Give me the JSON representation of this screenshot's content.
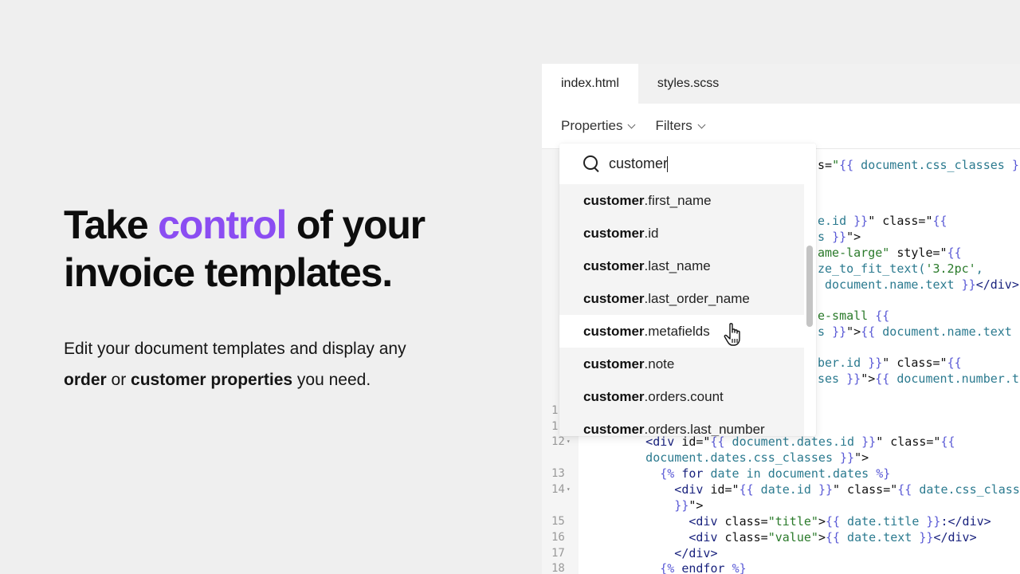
{
  "hero": {
    "headline_pre": "Take ",
    "headline_accent": "control",
    "headline_post": " of your",
    "headline_line2": "invoice templates.",
    "sub_line1": "Edit your document templates and display any",
    "sub_bold1": "order",
    "sub_mid": " or ",
    "sub_bold2": "customer properties",
    "sub_end": " you need.",
    "accent_color": "#8b4df2"
  },
  "editor": {
    "tabs": [
      {
        "label": "index.html",
        "active": true
      },
      {
        "label": "styles.scss",
        "active": false
      }
    ],
    "toolbar": {
      "properties_label": "Properties",
      "filters_label": "Filters",
      "chevron_icon": "chevron-down-icon"
    },
    "code_lines": [
      {
        "num": "",
        "segments": [
          {
            "c": "t-plain",
            "t": "s="
          },
          {
            "c": "t-str",
            "t": "\""
          },
          {
            "c": "t-brace",
            "t": "{{"
          },
          {
            "c": "t-var",
            "t": " document.css_classes "
          },
          {
            "c": "t-brace",
            "t": "}"
          }
        ]
      },
      {
        "num": "",
        "segments": [
          {
            "c": "t-var",
            "t": "e.id "
          },
          {
            "c": "t-brace",
            "t": "}}"
          },
          {
            "c": "t-plain",
            "t": "\" class=\""
          },
          {
            "c": "t-brace",
            "t": "{{"
          }
        ]
      },
      {
        "num": "",
        "segments": [
          {
            "c": "t-var",
            "t": "s "
          },
          {
            "c": "t-brace",
            "t": "}}"
          },
          {
            "c": "t-plain",
            "t": "\">"
          }
        ]
      },
      {
        "num": "",
        "segments": [
          {
            "c": "t-str",
            "t": "ame-large\""
          },
          {
            "c": "t-plain",
            "t": " style=\""
          },
          {
            "c": "t-brace",
            "t": "{{"
          }
        ]
      },
      {
        "num": "",
        "segments": [
          {
            "c": "t-var",
            "t": "ze_to_fit_text("
          },
          {
            "c": "t-str",
            "t": "'3.2pc'"
          },
          {
            "c": "t-var",
            "t": ","
          }
        ]
      },
      {
        "num": "",
        "segments": [
          {
            "c": "t-var",
            "t": " document.name.text "
          },
          {
            "c": "t-brace",
            "t": "}}"
          },
          {
            "c": "t-tag",
            "t": "</div>"
          }
        ]
      },
      {
        "num": "",
        "segments": [
          {
            "c": "t-str",
            "t": "e-small "
          },
          {
            "c": "t-brace",
            "t": "{{"
          }
        ]
      },
      {
        "num": "",
        "segments": [
          {
            "c": "t-var",
            "t": "s "
          },
          {
            "c": "t-brace",
            "t": "}}"
          },
          {
            "c": "t-plain",
            "t": "\">"
          },
          {
            "c": "t-brace",
            "t": "{{"
          },
          {
            "c": "t-var",
            "t": " document.name.text"
          }
        ]
      },
      {
        "num": "",
        "segments": [
          {
            "c": "t-var",
            "t": "ber.id "
          },
          {
            "c": "t-brace",
            "t": "}}"
          },
          {
            "c": "t-plain",
            "t": "\" class=\""
          },
          {
            "c": "t-brace",
            "t": "{{"
          }
        ]
      },
      {
        "num": "",
        "segments": [
          {
            "c": "t-var",
            "t": "ses "
          },
          {
            "c": "t-brace",
            "t": "}}"
          },
          {
            "c": "t-plain",
            "t": "\">"
          },
          {
            "c": "t-brace",
            "t": "{{"
          },
          {
            "c": "t-var",
            "t": " document.number.t"
          }
        ]
      }
    ],
    "lower_lines": [
      {
        "num": "1",
        "fold": false,
        "segments": []
      },
      {
        "num": "1",
        "fold": false,
        "segments": []
      },
      {
        "num": "12",
        "fold": true,
        "segments": [
          {
            "c": "t-tag",
            "t": "      <div "
          },
          {
            "c": "t-plain",
            "t": "id=\""
          },
          {
            "c": "t-brace",
            "t": "{{"
          },
          {
            "c": "t-var",
            "t": " document.dates.id "
          },
          {
            "c": "t-brace",
            "t": "}}"
          },
          {
            "c": "t-plain",
            "t": "\" class=\""
          },
          {
            "c": "t-brace",
            "t": "{{"
          }
        ]
      },
      {
        "num": "",
        "fold": false,
        "segments": [
          {
            "c": "t-var",
            "t": "      document.dates.css_classes "
          },
          {
            "c": "t-brace",
            "t": "}}"
          },
          {
            "c": "t-plain",
            "t": "\">"
          }
        ]
      },
      {
        "num": "13",
        "fold": false,
        "segments": [
          {
            "c": "t-brace",
            "t": "        {%"
          },
          {
            "c": "t-kw",
            "t": " for "
          },
          {
            "c": "t-var",
            "t": "date in document.dates "
          },
          {
            "c": "t-brace",
            "t": "%}"
          }
        ]
      },
      {
        "num": "14",
        "fold": true,
        "segments": [
          {
            "c": "t-tag",
            "t": "          <div "
          },
          {
            "c": "t-plain",
            "t": "id=\""
          },
          {
            "c": "t-brace",
            "t": "{{"
          },
          {
            "c": "t-var",
            "t": " date.id "
          },
          {
            "c": "t-brace",
            "t": "}}"
          },
          {
            "c": "t-plain",
            "t": "\" class=\""
          },
          {
            "c": "t-brace",
            "t": "{{"
          },
          {
            "c": "t-var",
            "t": " date.css_class"
          }
        ]
      },
      {
        "num": "",
        "fold": false,
        "segments": [
          {
            "c": "t-brace",
            "t": "          }}"
          },
          {
            "c": "t-plain",
            "t": "\">"
          }
        ]
      },
      {
        "num": "15",
        "fold": false,
        "segments": [
          {
            "c": "t-tag",
            "t": "            <div "
          },
          {
            "c": "t-plain",
            "t": "class="
          },
          {
            "c": "t-str",
            "t": "\"title\""
          },
          {
            "c": "t-plain",
            "t": ">"
          },
          {
            "c": "t-brace",
            "t": "{{"
          },
          {
            "c": "t-var",
            "t": " date.title "
          },
          {
            "c": "t-brace",
            "t": "}}"
          },
          {
            "c": "t-tag",
            "t": ":</div>"
          }
        ]
      },
      {
        "num": "16",
        "fold": false,
        "segments": [
          {
            "c": "t-tag",
            "t": "            <div "
          },
          {
            "c": "t-plain",
            "t": "class="
          },
          {
            "c": "t-str",
            "t": "\"value\""
          },
          {
            "c": "t-plain",
            "t": ">"
          },
          {
            "c": "t-brace",
            "t": "{{"
          },
          {
            "c": "t-var",
            "t": " date.text "
          },
          {
            "c": "t-brace",
            "t": "}}"
          },
          {
            "c": "t-tag",
            "t": "</div>"
          }
        ]
      },
      {
        "num": "17",
        "fold": false,
        "segments": [
          {
            "c": "t-tag",
            "t": "          </div>"
          }
        ]
      },
      {
        "num": "18",
        "fold": false,
        "segments": [
          {
            "c": "t-brace",
            "t": "        {%"
          },
          {
            "c": "t-kw",
            "t": " endfor "
          },
          {
            "c": "t-brace",
            "t": "%}"
          }
        ]
      }
    ]
  },
  "dropdown": {
    "search_value": "customer",
    "search_icon": "search-icon",
    "items": [
      {
        "bold": "customer",
        "rest": ".first_name",
        "hover": false
      },
      {
        "bold": "customer",
        "rest": ".id",
        "hover": false
      },
      {
        "bold": "customer",
        "rest": ".last_name",
        "hover": false
      },
      {
        "bold": "customer",
        "rest": ".last_order_name",
        "hover": false
      },
      {
        "bold": "customer",
        "rest": ".metafields",
        "hover": true
      },
      {
        "bold": "customer",
        "rest": ".note",
        "hover": false
      },
      {
        "bold": "customer",
        "rest": ".orders.count",
        "hover": false
      },
      {
        "bold": "customer",
        "rest": ".orders.last_number",
        "hover": false
      }
    ]
  }
}
